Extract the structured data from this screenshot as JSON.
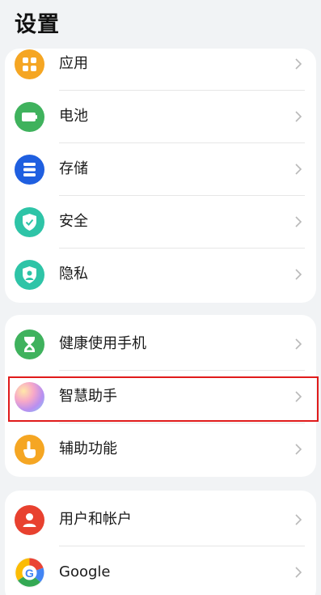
{
  "header": {
    "title": "设置"
  },
  "group1": {
    "items": [
      {
        "label": "应用",
        "icon": "apps-icon",
        "color": "#f5a623"
      },
      {
        "label": "电池",
        "icon": "battery-icon",
        "color": "#3fb25d"
      },
      {
        "label": "存储",
        "icon": "storage-icon",
        "color": "#1f5fe0"
      },
      {
        "label": "安全",
        "icon": "shield-check-icon",
        "color": "#2ec4a7"
      },
      {
        "label": "隐私",
        "icon": "privacy-icon",
        "color": "#2ec4a7"
      }
    ]
  },
  "group2": {
    "items": [
      {
        "label": "健康使用手机",
        "icon": "hourglass-icon",
        "color": "#3fb25d"
      },
      {
        "label": "智慧助手",
        "icon": "assistant-orb-icon",
        "color": "#c98be6"
      },
      {
        "label": "辅助功能",
        "icon": "hand-pointer-icon",
        "color": "#f5a623"
      }
    ]
  },
  "group3": {
    "items": [
      {
        "label": "用户和帐户",
        "icon": "user-icon",
        "color": "#e8412f"
      },
      {
        "label": "Google",
        "icon": "google-icon",
        "color": "#ffffff"
      }
    ]
  },
  "highlight": {
    "color": "#e01b1b",
    "target": "智慧助手"
  }
}
